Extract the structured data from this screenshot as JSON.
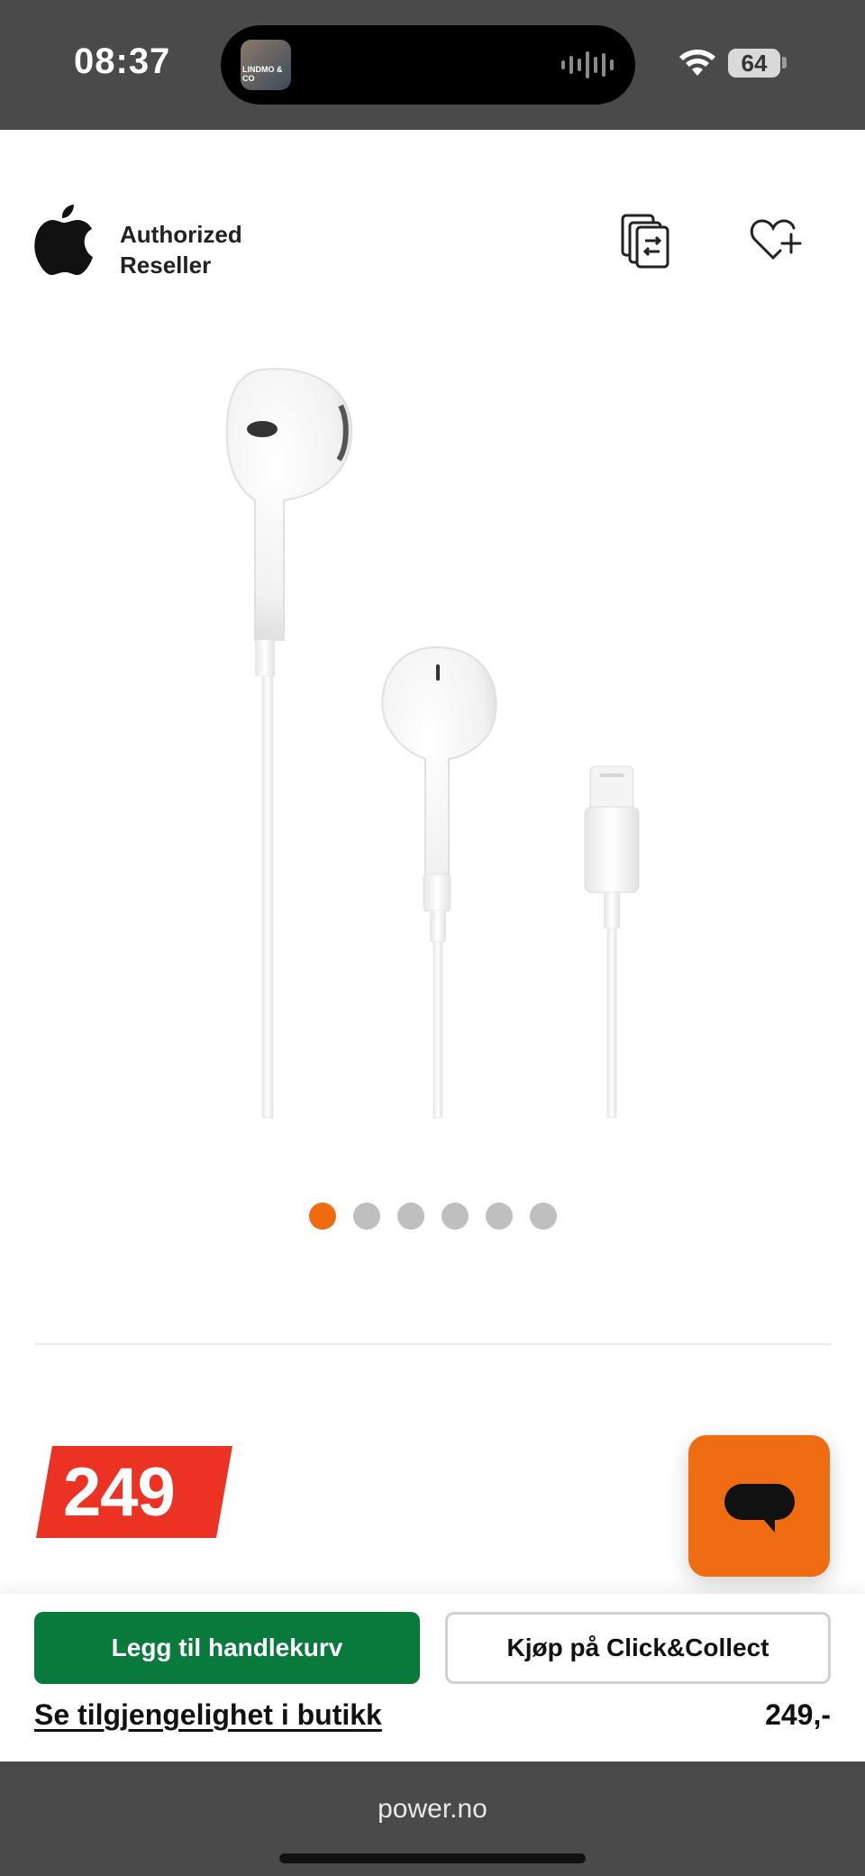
{
  "status_bar": {
    "time": "08:37",
    "island_thumb_label": "LINDMO & CO",
    "battery_level": "64"
  },
  "header": {
    "reseller_line1": "Authorized",
    "reseller_line2": "Reseller"
  },
  "carousel": {
    "total_images": 6,
    "active_index": 0
  },
  "price_tag": "249",
  "actions": {
    "add_to_cart": "Legg til handlekurv",
    "click_collect": "Kjøp på Click&Collect",
    "store_availability": "Se tilgjengelighet i butikk",
    "price": "249,-"
  },
  "browser": {
    "url": "power.no"
  },
  "colors": {
    "accent_orange": "#f06a0f",
    "price_red": "#ec3323",
    "cart_green": "#0a7a3c"
  }
}
